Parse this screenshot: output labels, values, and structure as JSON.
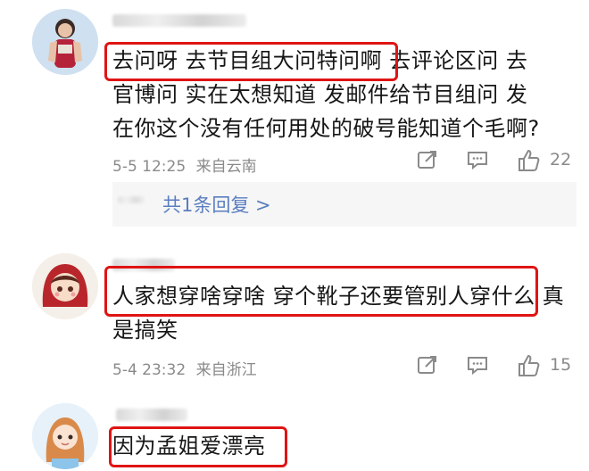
{
  "comments": [
    {
      "lines": [
        "去问呀  去节目组大问特问啊  去评论区问  去",
        "官博问  实在太想知道  发邮件给节目组问  发",
        "在你这个没有任何用处的破号能知道个毛啊?"
      ],
      "time": "5-5 12:25",
      "location": "来自云南",
      "likes": "22",
      "reply_label": "共1条回复 >"
    },
    {
      "lines": [
        "人家想穿啥穿啥  穿个靴子还要管别人穿什么  真",
        "是搞笑"
      ],
      "time": "5-4 23:32",
      "location": "来自浙江",
      "likes": "15"
    },
    {
      "lines": [
        "因为孟姐爱漂亮"
      ]
    }
  ],
  "icons": [
    "share-icon",
    "comment-icon",
    "like-icon"
  ]
}
